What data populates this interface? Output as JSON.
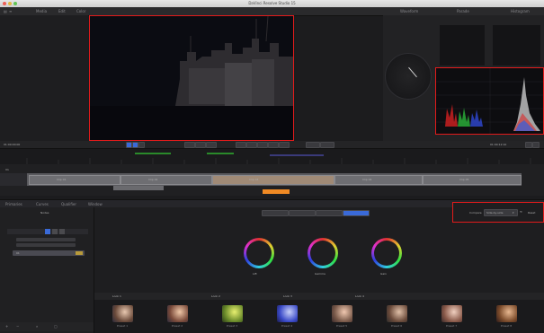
{
  "app": {
    "title": "DaVinci Resolve Studio 15"
  },
  "menubar": {
    "left": [
      "Media",
      "Edit",
      "Color"
    ],
    "right_tabs": [
      "Waveform",
      "Parade",
      "Histogram"
    ]
  },
  "viewer": {
    "timecode_left": "01:00:00:00",
    "timecode_right": "01:00:12:10"
  },
  "timeline": {
    "track_label": "V1",
    "clip_labels": [
      "Clip 01",
      "Clip 02",
      "Clip 03",
      "Clip 04",
      "Clip 05",
      "Clip 06"
    ]
  },
  "nodes": {
    "title": "Nodes",
    "node_label": "01"
  },
  "color_tabs": [
    "Primaries",
    "Curves",
    "Qualifier",
    "Window"
  ],
  "active_tab": "Window",
  "wheels": {
    "labels": [
      "Lift",
      "Gamma",
      "Gain"
    ]
  },
  "presets": {
    "dropdown_label": "Compare",
    "dropdown_value": "Side-by-side",
    "reset_label": "Reset",
    "header_labels": [
      "Look 1",
      "Look 2",
      "Look 3",
      "Look 4"
    ],
    "swatch_labels": [
      "Preset 1",
      "Preset 2",
      "Preset 3",
      "Preset 4",
      "Preset 5",
      "Preset 6",
      "Preset 7",
      "Preset 8"
    ]
  },
  "colors": {
    "accent": "#e21b1b",
    "panel": "#222224",
    "background": "#1c1c1e",
    "playhead": "#f08a24"
  }
}
